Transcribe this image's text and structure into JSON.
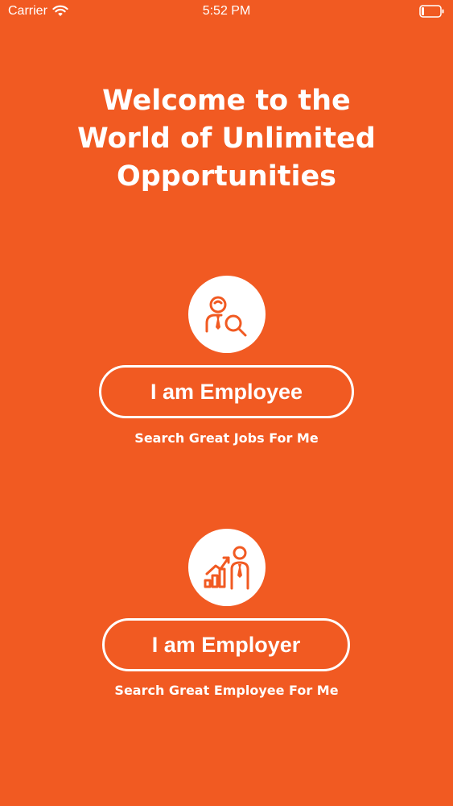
{
  "status_bar": {
    "carrier": "Carrier",
    "time": "5:52 PM",
    "wifi_icon": "wifi-icon",
    "battery_icon": "battery-icon"
  },
  "welcome": {
    "line1": "Welcome to the",
    "line2": "World of Unlimited",
    "line3": "Opportunities"
  },
  "employee": {
    "icon": "job-search-person-icon",
    "button_label": "I am Employee",
    "subtitle": "Search Great Jobs For Me"
  },
  "employer": {
    "icon": "growth-chart-person-icon",
    "button_label": "I am Employer",
    "subtitle": "Search Great Employee For Me"
  },
  "colors": {
    "background": "#f15a22",
    "foreground": "#ffffff",
    "accent": "#f15a22"
  }
}
